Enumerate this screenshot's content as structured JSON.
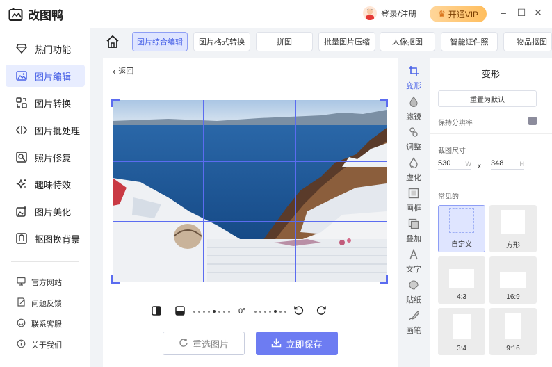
{
  "app": {
    "title": "改图鸭",
    "login_label": "登录/注册",
    "vip_label": "开通VIP",
    "accent": "#5b6cf0"
  },
  "window_controls": [
    "–",
    "☐",
    "✕"
  ],
  "sidebar": {
    "items": [
      {
        "label": "热门功能",
        "icon": "gem-icon"
      },
      {
        "label": "图片编辑",
        "icon": "image-edit-icon"
      },
      {
        "label": "图片转换",
        "icon": "convert-icon"
      },
      {
        "label": "图片批处理",
        "icon": "batch-icon"
      },
      {
        "label": "照片修复",
        "icon": "repair-icon"
      },
      {
        "label": "趣味特效",
        "icon": "sparkle-icon"
      },
      {
        "label": "图片美化",
        "icon": "beautify-icon"
      },
      {
        "label": "抠图换背景",
        "icon": "cutout-icon"
      }
    ],
    "links": [
      {
        "label": "官方网站",
        "icon": "monitor-icon"
      },
      {
        "label": "问题反馈",
        "icon": "feedback-icon"
      },
      {
        "label": "联系客服",
        "icon": "service-icon"
      },
      {
        "label": "关于我们",
        "icon": "info-icon"
      }
    ]
  },
  "tabs": [
    "图片综合编辑",
    "图片格式转换",
    "拼图",
    "批量图片压缩",
    "人像抠图",
    "智能证件照",
    "物品抠图"
  ],
  "editor": {
    "back_label": "返回",
    "rotation": "0°",
    "reselect_label": "重选图片",
    "save_label": "立即保存"
  },
  "toolbar": [
    "变形",
    "滤镜",
    "调整",
    "虚化",
    "画框",
    "叠加",
    "文字",
    "贴纸",
    "画笔"
  ],
  "panel": {
    "title": "变形",
    "reset_label": "重置为默认",
    "keep_label": "保持分辨率",
    "size_label": "裁图尺寸",
    "width": "530",
    "width_unit": "W",
    "times": "x",
    "height": "348",
    "height_unit": "H",
    "common_label": "常见的",
    "presets": [
      "自定义",
      "方形",
      "4:3",
      "16:9",
      "3:4",
      "9:16"
    ]
  }
}
